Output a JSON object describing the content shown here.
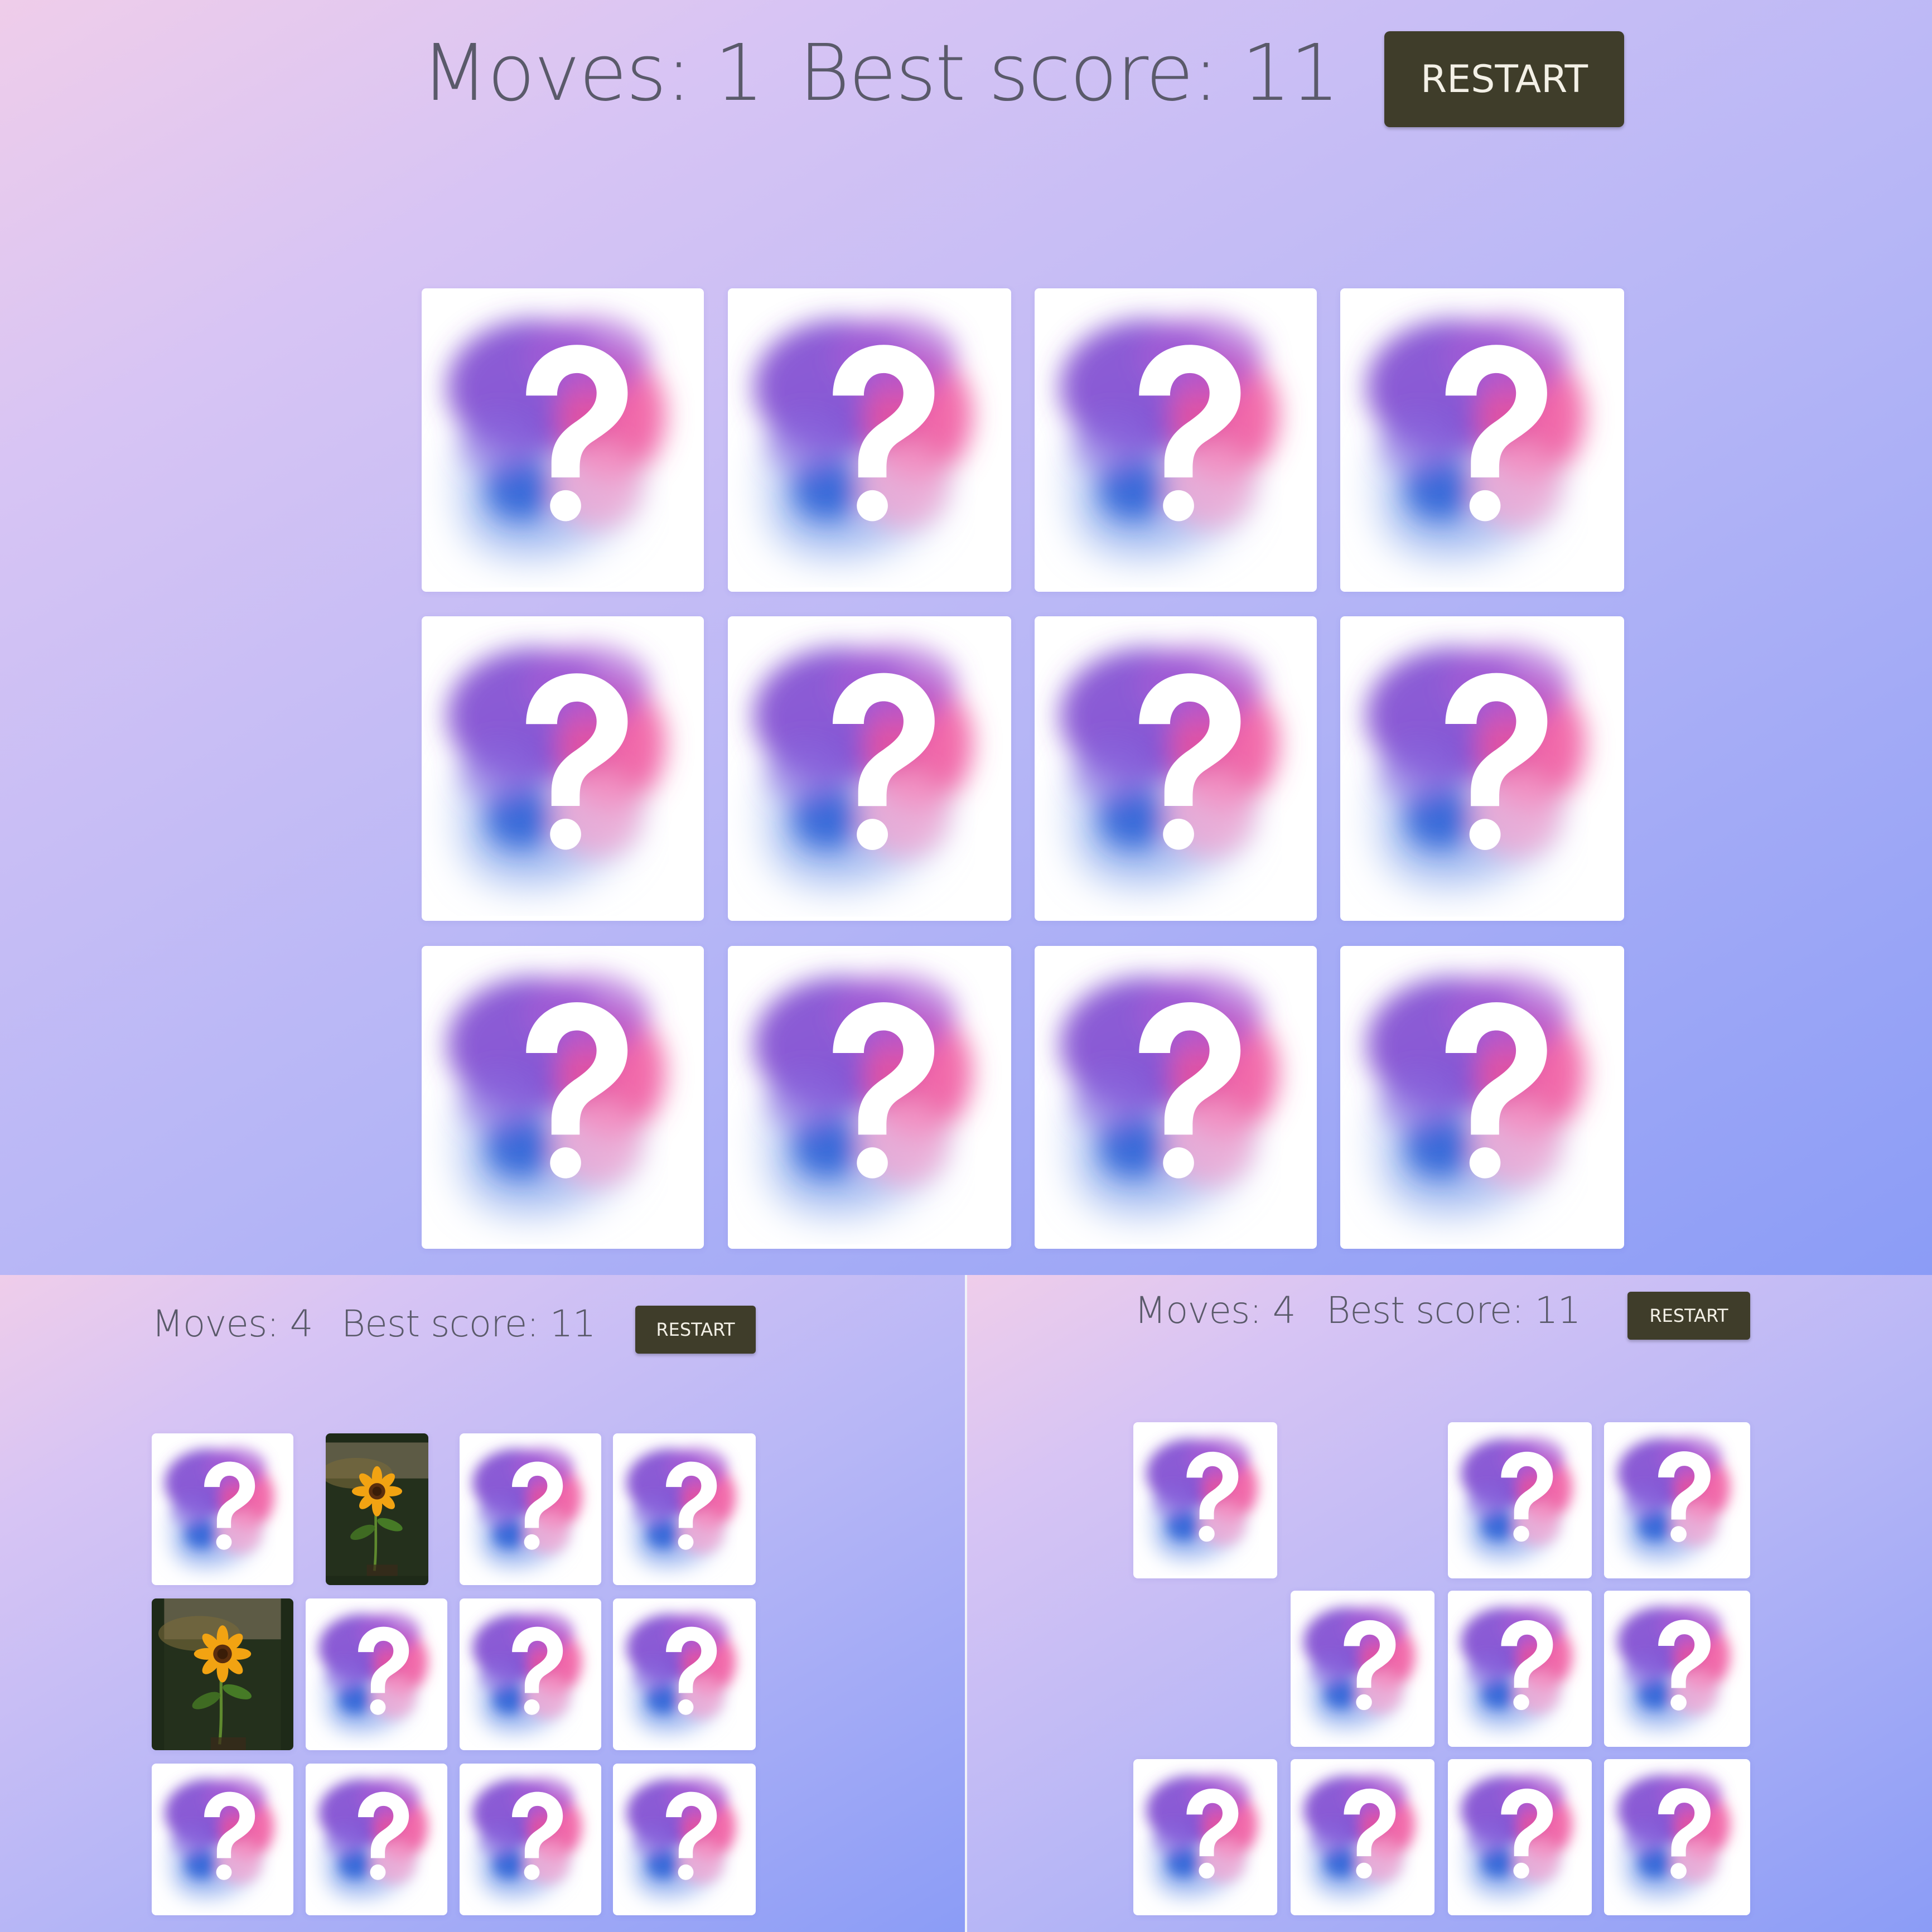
{
  "main": {
    "moves_label": "Moves: 1",
    "best_label": "Best score: 11",
    "restart_label": "RESTART"
  },
  "left_view": {
    "moves_label": "Moves: 4",
    "best_label": "Best score: 11",
    "restart_label": "RESTART",
    "revealed_card": "sunflower photo"
  },
  "right_view": {
    "moves_label": "Moves: 4",
    "best_label": "Best score: 11",
    "restart_label": "RESTART",
    "removed_cards": 2
  },
  "card_back_icon": "question-mark-watercolor-icon",
  "colors": {
    "restart_bg": "#3f3d2a",
    "text": "#5a5a6a",
    "bg_top": "#efcdea",
    "bg_bottom": "#8b9cf6"
  }
}
